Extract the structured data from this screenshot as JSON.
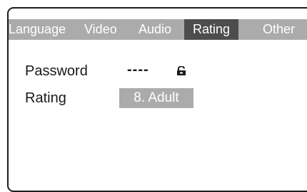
{
  "tabs": [
    {
      "label": "Language",
      "selected": false
    },
    {
      "label": "Video",
      "selected": false
    },
    {
      "label": "Audio",
      "selected": false
    },
    {
      "label": "Rating",
      "selected": true
    },
    {
      "label": "Other",
      "selected": false
    }
  ],
  "settings": {
    "password_label": "Password",
    "password_value": "----",
    "password_icon": "lock-icon",
    "rating_label": "Rating",
    "rating_value": "8. Adult"
  },
  "colors": {
    "tab_bar": "#ababab",
    "tab_selected": "#4d4d4d",
    "value_highlight": "#ababab",
    "text": "#1a1a1a"
  }
}
